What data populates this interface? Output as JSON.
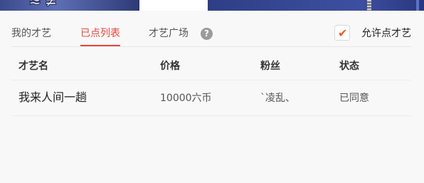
{
  "tabs": [
    {
      "label": "我的才艺",
      "active": false
    },
    {
      "label": "已点列表",
      "active": true
    },
    {
      "label": "才艺广场",
      "active": false
    }
  ],
  "help_icon": "question-mark-icon",
  "allow": {
    "label": "允许点才艺",
    "checked": true,
    "check_color": "#f25a1c"
  },
  "table": {
    "headers": [
      "才艺名",
      "价格",
      "粉丝",
      "状态"
    ],
    "rows": [
      {
        "name": "我来人间一趟",
        "price": "10000六币",
        "fan": "`凌乱、",
        "status": "已同意"
      }
    ]
  },
  "colors": {
    "accent": "#e8463c",
    "banner": "#3a4a8a"
  }
}
